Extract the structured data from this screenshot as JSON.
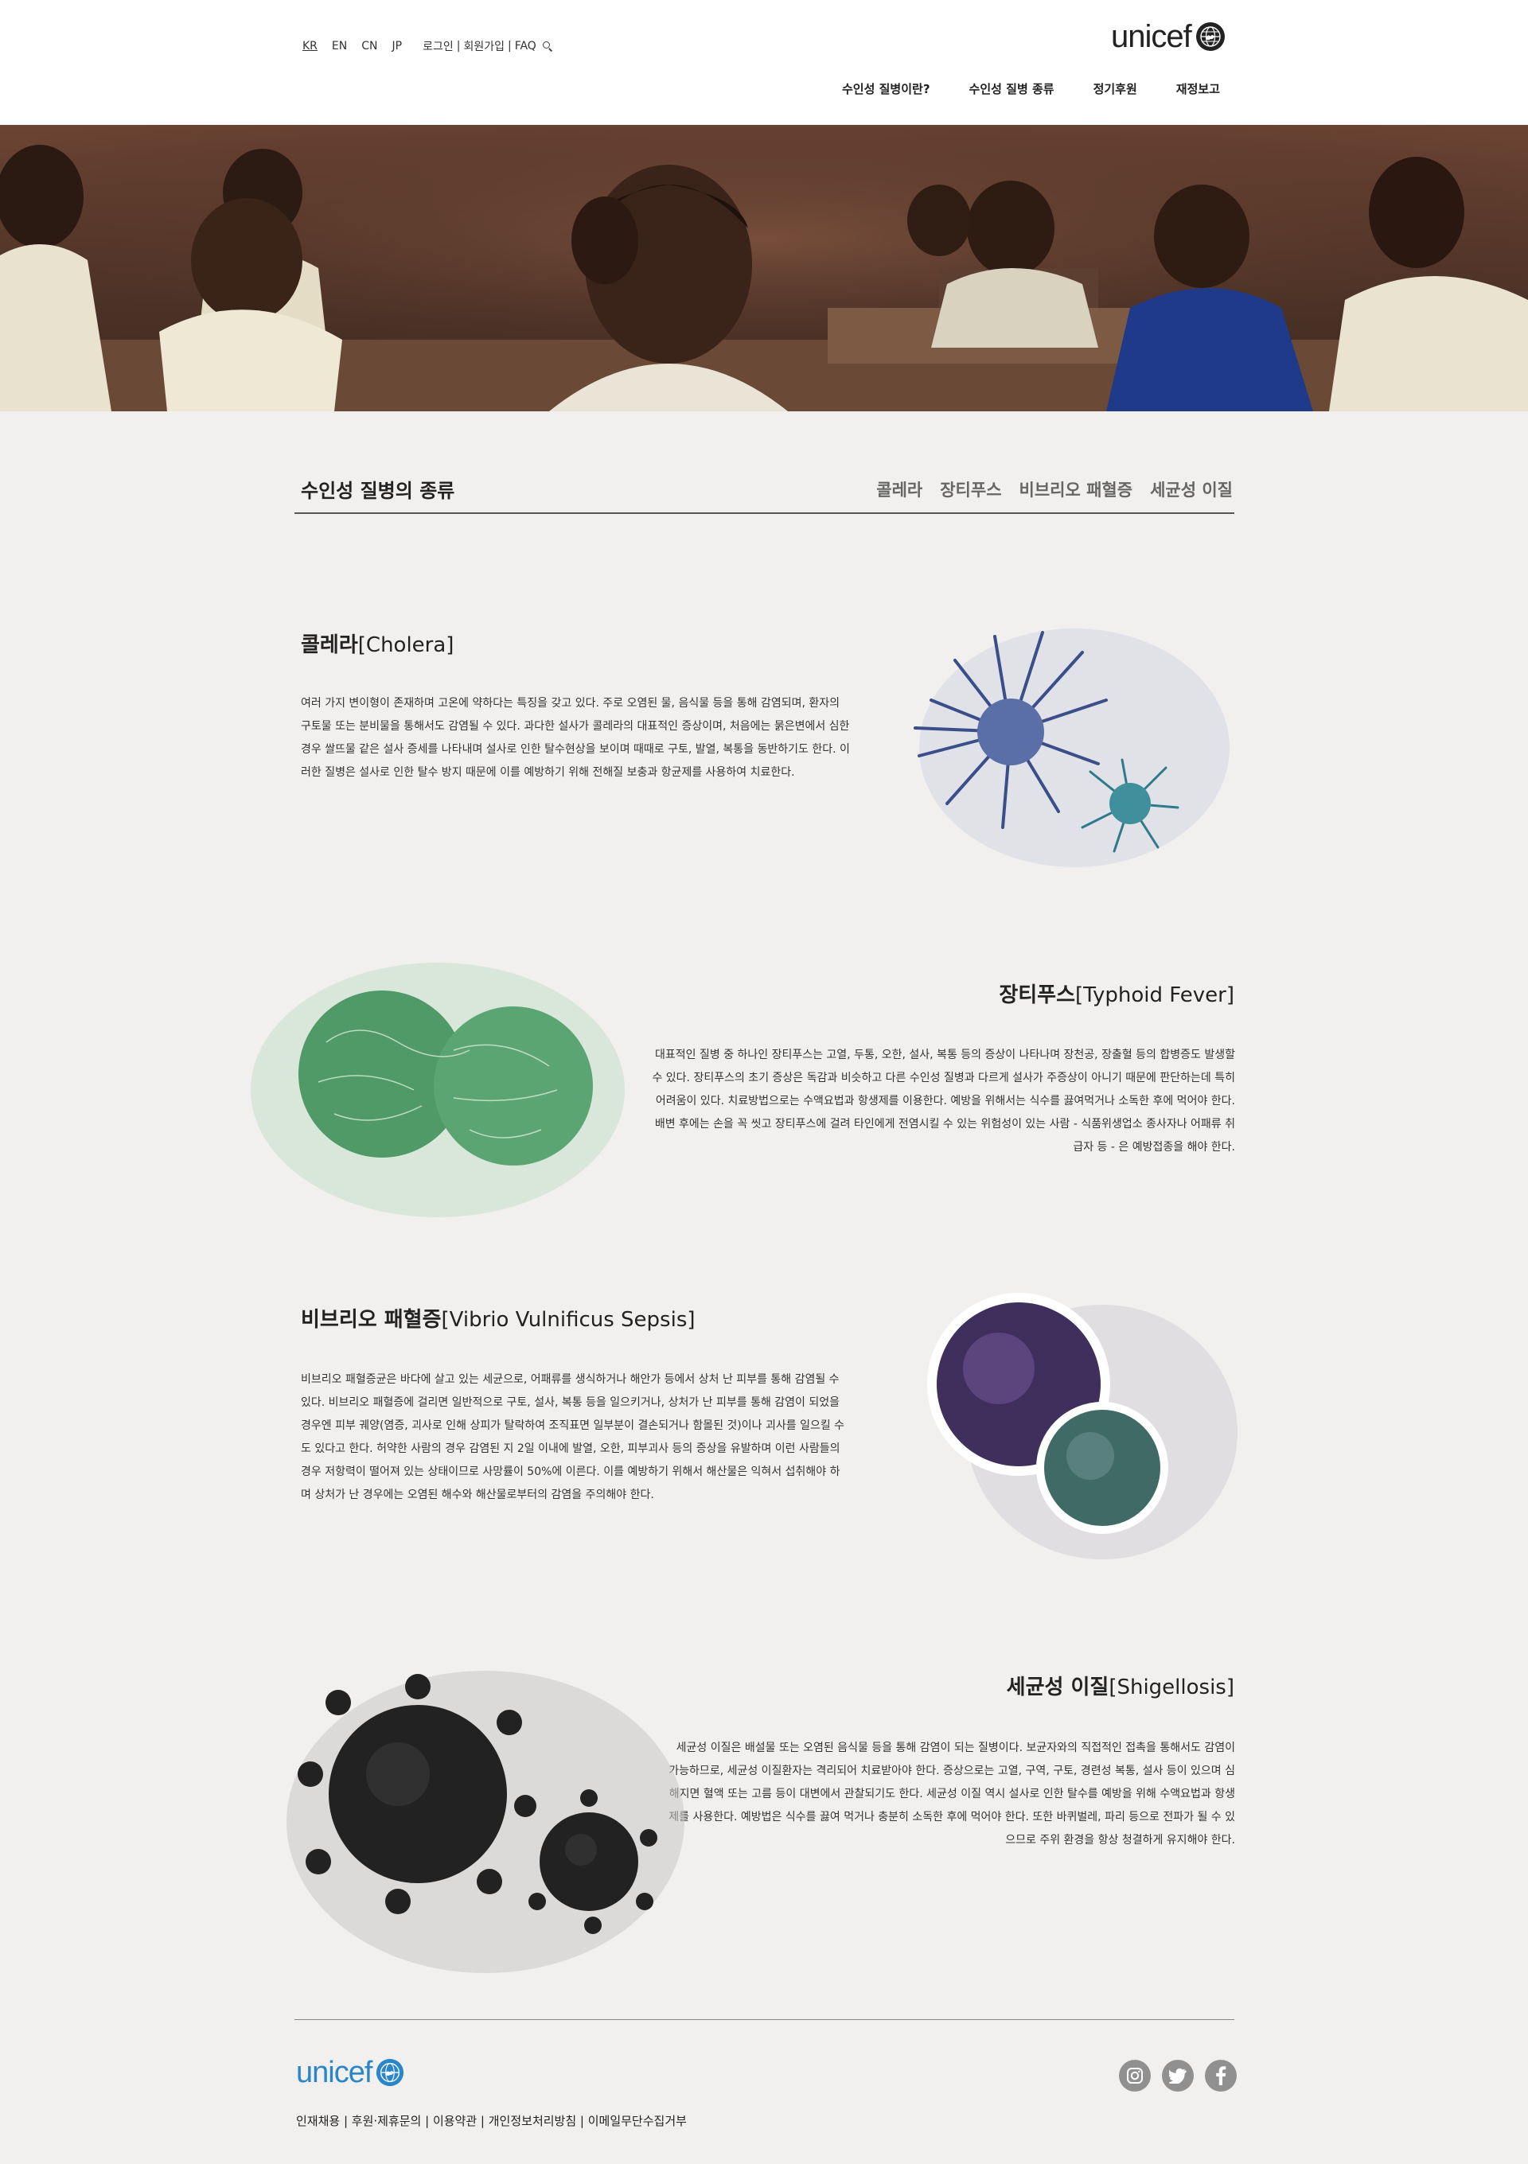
{
  "header": {
    "languages": [
      {
        "label": "KR",
        "active": true
      },
      {
        "label": "EN",
        "active": false
      },
      {
        "label": "CN",
        "active": false
      },
      {
        "label": "JP",
        "active": false
      }
    ],
    "login": "로그인",
    "signup": "회원가입",
    "faq": "FAQ",
    "logo_text": "unicef",
    "search_icon": "search-icon",
    "nav": [
      {
        "label": "수인성 질병이란?"
      },
      {
        "label": "수인성 질병 종류"
      },
      {
        "label": "정기후원"
      },
      {
        "label": "재정보고"
      }
    ]
  },
  "section": {
    "title": "수인성 질병의 종류",
    "tabs": [
      {
        "label": "콜레라"
      },
      {
        "label": "장티푸스"
      },
      {
        "label": "비브리오 패혈증"
      },
      {
        "label": "세균성 이질"
      }
    ]
  },
  "diseases": [
    {
      "name_ko": "콜레라",
      "name_en": "[Cholera]",
      "text": "여러 가지 변이형이 존재하며 고온에 약하다는 특징을 갖고 있다. 주로 오염된 물, 음식물 등을 통해 감염되며, 환자의 구토물 또는 분비물을 통해서도 감염될 수 있다. 과다한 설사가 콜레라의 대표적인 증상이며, 처음에는 묽은변에서 심한 경우 쌀뜨물 같은 설사 증세를 나타내며 설사로 인한 탈수현상을 보이며 때때로 구토, 발열, 복통을 동반하기도 한다. 이러한 질병은 설사로 인한 탈수 방지 때문에 이를 예방하기 위해 전해질 보충과 항균제를 사용하여 치료한다."
    },
    {
      "name_ko": "장티푸스",
      "name_en": "[Typhoid Fever]",
      "text": "대표적인 질병 중 하나인 장티푸스는 고열, 두통, 오한, 설사, 복통 등의 증상이 나타나며 장천공, 장출혈 등의 합병증도 발생할 수 있다. 장티푸스의 초기 증상은 독감과 비슷하고 다른 수인성 질병과 다르게 설사가 주증상이 아니기 때문에 판단하는데 특히 어려움이 있다. 치료방법으로는 수액요법과 항생제를 이용한다. 예방을 위해서는 식수를 끓여먹거나 소독한 후에 먹어야 한다. 배변 후에는 손을 꼭 씻고 장티푸스에 걸려 타인에게 전염시킬 수 있는 위험성이 있는 사람 - 식품위생업소 종사자나 어패류 취급자 등 - 은 예방접종을 해야 한다."
    },
    {
      "name_ko": "비브리오 패혈증",
      "name_en": "[Vibrio Vulnificus Sepsis]",
      "text": "비브리오 패혈증균은 바다에 살고 있는 세균으로, 어패류를 생식하거나 해안가 등에서 상처 난 피부를 통해 감염될 수 있다. 비브리오 패혈증에 걸리면 일반적으로 구토, 설사, 복통 등을 일으키거나, 상처가 난 피부를 통해 감염이 되었을 경우엔 피부 궤양(염증, 괴사로 인해 상피가 탈락하여 조직표면 일부분이 결손되거나 함몰된 것)이나 괴사를 일으킬 수도 있다고 한다. 허약한 사람의 경우 감염된 지 2일 이내에 발열, 오한, 피부괴사 등의 증상을 유발하며 이런 사람들의 경우 저항력이 떨어져 있는 상태이므로 사망률이 50%에 이른다. 이를 예방하기 위해서 해산물은 익혀서 섭취해야 하며 상처가 난 경우에는 오염된 해수와 해산물로부터의 감염을 주의해야 한다."
    },
    {
      "name_ko": "세균성 이질",
      "name_en": "[Shigellosis]",
      "text": "세균성 이질은 배설물 또는 오염된 음식물 등을 통해 감염이 되는 질병이다. 보균자와의 직접적인 접촉을 통해서도 감염이 가능하므로, 세균성 이질환자는 격리되어 치료받아야 한다. 증상으로는 고열, 구역, 구토, 경련성 복통, 설사 등이 있으며 심해지면 혈액 또는 고름 등이 대변에서 관찰되기도 한다. 세균성 이질 역시 설사로 인한 탈수를 예방을 위해 수액요법과 항생제를 사용한다. 예방법은 식수를 끓여 먹거나 충분히 소독한 후에 먹어야 한다. 또한 바퀴벌레, 파리 등으로 전파가 될 수 있으므로 주위 환경을 항상 청결하게 유지해야 한다."
    }
  ],
  "footer": {
    "logo_text": "unicef",
    "social": [
      {
        "icon": "instagram-icon"
      },
      {
        "icon": "twitter-icon"
      },
      {
        "icon": "facebook-icon"
      }
    ],
    "links": "인재채용 | 후원·제휴문의 | 이용약관 | 개인정보처리방침 | 이메일무단수집거부"
  },
  "colors": {
    "page_bg": "#f1f0ee",
    "header_bg": "#ffffff",
    "footer_logo": "#2a86c8",
    "social_icons": "#909090"
  }
}
